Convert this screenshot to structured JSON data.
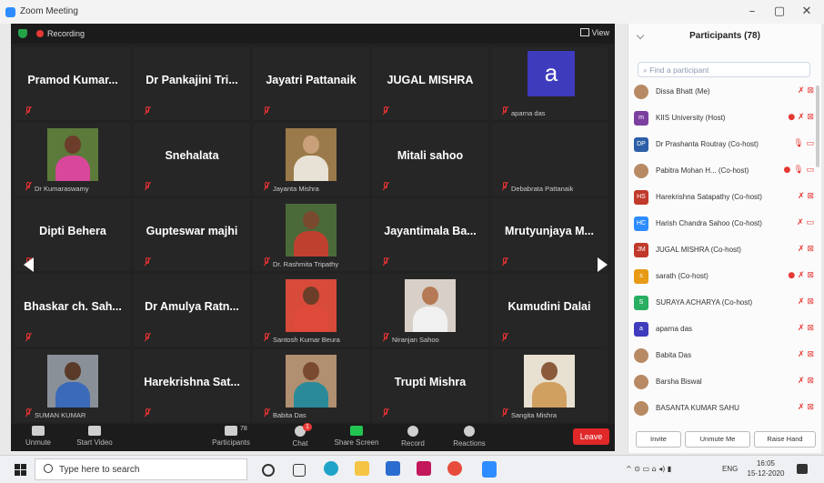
{
  "window": {
    "title": "Zoom Meeting",
    "min": "–",
    "max": "▢",
    "close": "✕"
  },
  "meeting": {
    "recording_label": "Recording",
    "view_label": "View",
    "tiles": [
      {
        "name": "Pramod Kumar...",
        "style": "name",
        "col": 0,
        "row": 0
      },
      {
        "name": "Dr Pankajini Tri...",
        "style": "name",
        "col": 1,
        "row": 0
      },
      {
        "name": "Jayatri Pattanaik",
        "style": "name",
        "col": 2,
        "row": 0
      },
      {
        "name": "JUGAL MISHRA",
        "style": "name",
        "col": 3,
        "row": 0
      },
      {
        "small": "aparna das",
        "style": "avatar",
        "letter": "a",
        "col": 4,
        "row": 0
      },
      {
        "small": "Dr Kumaraswamy",
        "style": "photo",
        "col": 0,
        "row": 1,
        "skin": "#6b3d2a",
        "cloth": "#d8479a",
        "bg": "#5c7a3a"
      },
      {
        "name": "Snehalata",
        "style": "name",
        "col": 1,
        "row": 1
      },
      {
        "small": "Jayanta Mishra",
        "style": "photo",
        "col": 2,
        "row": 1,
        "skin": "#c9a07a",
        "cloth": "#e8e2d6",
        "bg": "#9a7a4a"
      },
      {
        "name": "Mitali sahoo",
        "style": "name",
        "col": 3,
        "row": 1
      },
      {
        "small": "Debabrata Pattanaik",
        "style": "name",
        "col": 4,
        "row": 1
      },
      {
        "name": "Dipti Behera",
        "style": "name",
        "col": 0,
        "row": 2
      },
      {
        "name": "Gupteswar majhi",
        "style": "name",
        "col": 1,
        "row": 2
      },
      {
        "small": "Dr. Rashmita Tripathy",
        "style": "photo",
        "col": 2,
        "row": 2,
        "skin": "#7a4a2e",
        "cloth": "#c04030",
        "bg": "#4a6a3a"
      },
      {
        "name": "Jayantimala Ba...",
        "style": "name",
        "col": 3,
        "row": 2
      },
      {
        "name": "Mrutyunjaya M...",
        "style": "name",
        "col": 4,
        "row": 2
      },
      {
        "name": "Bhaskar ch. Sah...",
        "style": "name",
        "col": 0,
        "row": 3
      },
      {
        "name": "Dr Amulya Ratn...",
        "style": "name",
        "col": 1,
        "row": 3
      },
      {
        "small": "Santosh Kumar Beura",
        "style": "photo",
        "col": 2,
        "row": 3,
        "skin": "#6a3e28",
        "cloth": "#e04a3a",
        "bg": "#d84a3a"
      },
      {
        "small": "Niranjan Sahoo",
        "style": "photo",
        "col": 3,
        "row": 3,
        "skin": "#b57a55",
        "cloth": "#f0f0f0",
        "bg": "#d8d0c8"
      },
      {
        "name": "Kumudini Dalai",
        "style": "name",
        "col": 4,
        "row": 3
      },
      {
        "small": "SUMAN KUMAR",
        "style": "photo",
        "col": 0,
        "row": 4,
        "skin": "#5a3a28",
        "cloth": "#3a6ab8",
        "bg": "#8a9098"
      },
      {
        "name": "Harekrishna Sat...",
        "style": "name",
        "col": 1,
        "row": 4
      },
      {
        "small": "Babita Das",
        "style": "photo",
        "col": 2,
        "row": 4,
        "skin": "#7a4a30",
        "cloth": "#2a8a9a",
        "bg": "#b09070"
      },
      {
        "name": "Trupti Mishra",
        "style": "name",
        "col": 3,
        "row": 4
      },
      {
        "small": "Sangita Mishra",
        "style": "photo",
        "col": 4,
        "row": 4,
        "skin": "#8a5a3a",
        "cloth": "#d0a060",
        "bg": "#e8e0d0"
      }
    ],
    "controls": [
      {
        "label": "Unmute",
        "key": "unmute"
      },
      {
        "label": "Start Video",
        "key": "start-video"
      },
      {
        "label": "Participants",
        "key": "participants",
        "count": "78"
      },
      {
        "label": "Chat",
        "key": "chat",
        "badge": "1"
      },
      {
        "label": "Share Screen",
        "key": "share-screen"
      },
      {
        "label": "Record",
        "key": "record"
      },
      {
        "label": "Reactions",
        "key": "reactions"
      }
    ],
    "leave_label": "Leave"
  },
  "participants_panel": {
    "title": "Participants (78)",
    "search_placeholder": "Find a participant",
    "rows": [
      {
        "name": "Dissa Bhatt (Me)",
        "initials": "",
        "color": "photo",
        "icons": "✗ ⊠"
      },
      {
        "name": "KIIS University (Host)",
        "initials": "m",
        "color": "#7b3fa0",
        "icons": "● ✗ ⊠"
      },
      {
        "name": "Dr Prashanta Routray (Co-host)",
        "initials": "DP",
        "color": "#2c5fa8",
        "icons": "🎙 ▭"
      },
      {
        "name": "Pabitra Mohan H... (Co-host)",
        "initials": "",
        "color": "photo",
        "icons": "● 🎙 ▭"
      },
      {
        "name": "Harekrishna Satapathy (Co-host)",
        "initials": "HS",
        "color": "#c0392b",
        "icons": "✗ ⊠"
      },
      {
        "name": "Harish Chandra Sahoo (Co-host)",
        "initials": "HC",
        "color": "#2d8cff",
        "icons": "✗ ▭"
      },
      {
        "name": "JUGAL MISHRA (Co-host)",
        "initials": "JM",
        "color": "#c0392b",
        "icons": "✗ ⊠"
      },
      {
        "name": "sarath (Co-host)",
        "initials": "s",
        "color": "#e69a16",
        "icons": "● ✗ ⊠"
      },
      {
        "name": "SURAYA ACHARYA (Co-host)",
        "initials": "S",
        "color": "#27ae60",
        "icons": "✗ ⊠"
      },
      {
        "name": "aparna das",
        "initials": "a",
        "color": "#3e3bbd",
        "icons": "✗ ⊠"
      },
      {
        "name": "Babita Das",
        "initials": "",
        "color": "photo",
        "icons": "✗ ⊠"
      },
      {
        "name": "Barsha Biswal",
        "initials": "",
        "color": "photo",
        "icons": "✗ ⊠"
      },
      {
        "name": "BASANTA KUMAR SAHU",
        "initials": "",
        "color": "photo",
        "icons": "✗ ⊠"
      }
    ],
    "invite_label": "Invite",
    "unmute_me_label": "Unmute Me",
    "raise_hand_label": "Raise Hand"
  },
  "taskbar": {
    "search_placeholder": "Type here to search",
    "language": "ENG",
    "time": "16:05",
    "date": "15-12-2020",
    "tray_icons": "^ ⊙ ▭ ⌂ ◂) ▮"
  }
}
